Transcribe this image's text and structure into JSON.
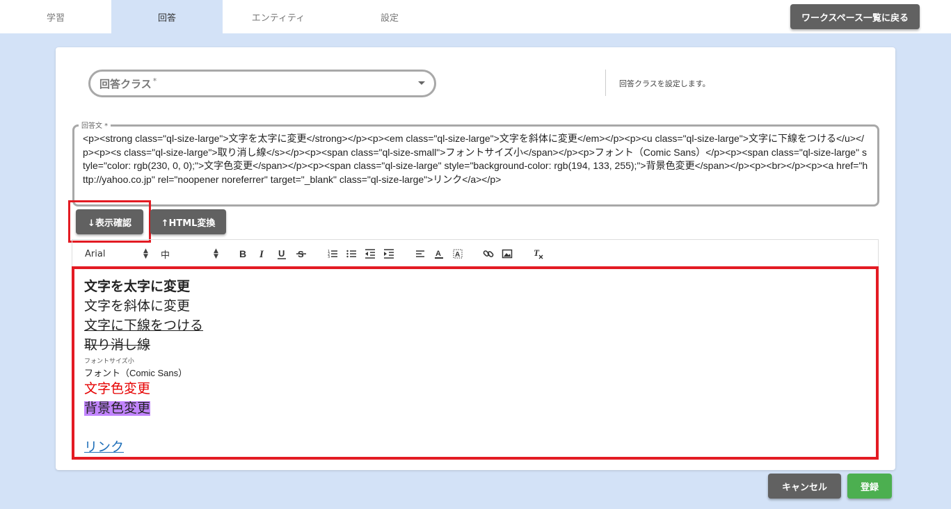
{
  "tabs": [
    {
      "label": "学習"
    },
    {
      "label": "回答"
    },
    {
      "label": "エンティティ"
    },
    {
      "label": "設定"
    }
  ],
  "header": {
    "back_label": "ワークスペース一覧に戻る"
  },
  "form": {
    "select_label": "回答クラス",
    "required_mark": "*",
    "hint": "回答クラスを設定します。",
    "answer_legend": "回答文 *",
    "answer_html": "<p><strong class=\"ql-size-large\">文字を太字に変更</strong></p><p><em class=\"ql-size-large\">文字を斜体に変更</em></p><p><u class=\"ql-size-large\">文字に下線をつける</u></p><p><s class=\"ql-size-large\">取り消し線</s></p><p><span class=\"ql-size-small\">フォントサイズ小</span></p><p>フォント（Comic Sans）</p><p><span class=\"ql-size-large\" style=\"color: rgb(230, 0, 0);\">文字色変更</span></p><p><span class=\"ql-size-large\" style=\"background-color: rgb(194, 133, 255);\">背景色変更</span></p><p><br></p><p><a href=\"http://yahoo.co.jp\" rel=\"noopener noreferrer\" target=\"_blank\" class=\"ql-size-large\">リンク</a></p>"
  },
  "buttons": {
    "preview_label": "↓表示確認",
    "convert_label": "↑HTML変換",
    "cancel_label": "キャンセル",
    "save_label": "登録"
  },
  "toolbar": {
    "font_value": "Arial",
    "size_value": "中",
    "icons": [
      "bold-icon",
      "italic-icon",
      "underline-icon",
      "strike-icon",
      "ordered-list-icon",
      "bullet-list-icon",
      "outdent-icon",
      "indent-icon",
      "align-icon",
      "text-color-icon",
      "background-color-icon",
      "link-icon",
      "image-icon",
      "clear-format-icon"
    ]
  },
  "editor": {
    "bold_line": "文字を太字に変更",
    "italic_line": "文字を斜体に変更",
    "underline_line": "文字に下線をつける",
    "strike_line": "取り消し線",
    "small_line": "フォントサイズ小",
    "font_line": "フォント（Comic Sans）",
    "red_line": "文字色変更",
    "bg_line": "背景色変更",
    "link_text": "リンク"
  },
  "colors": {
    "accent_bg": "#d3e2f7",
    "highlight_frame": "#e31b23",
    "save_green": "#4caf50",
    "text_red": "#e60000",
    "bg_purple": "#c285ff",
    "link_blue": "#1f6fb9"
  }
}
